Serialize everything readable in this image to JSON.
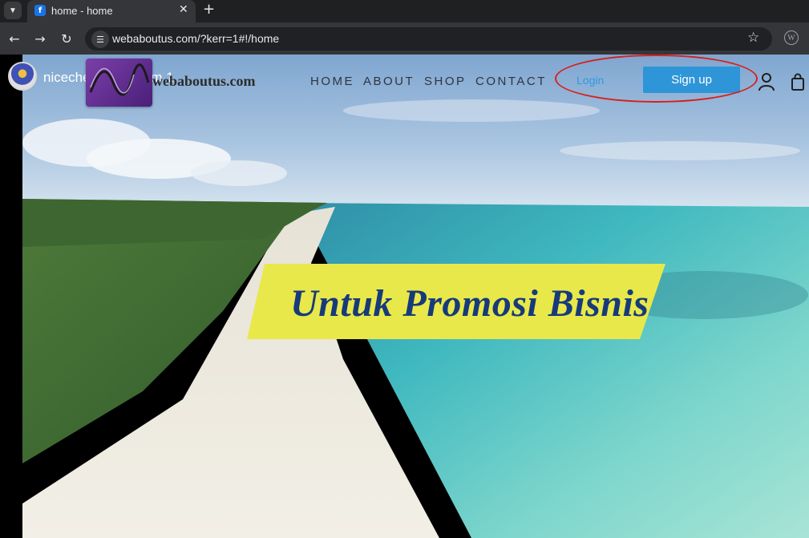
{
  "browser": {
    "tab_title": "home - home",
    "tab_favicon": "f",
    "url": "webaboutus.com/?kerr=1#!/home",
    "icons": [
      "tab-search-icon",
      "favicon-icon",
      "close-icon",
      "plus-icon",
      "back-arrow-icon",
      "forward-arrow-icon",
      "reload-icon",
      "site-info-icon",
      "star-icon",
      "wordpress-icon"
    ]
  },
  "site": {
    "name": "nicechea",
    "name_suffix": "om 1",
    "logo_text": "webaboutus.com",
    "nav": [
      "HOME",
      "ABOUT",
      "SHOP",
      "CONTACT"
    ],
    "login_label": "Login",
    "signup_label": "Sign up",
    "icons": [
      "user-icon",
      "shopping-bag-icon"
    ],
    "colors": {
      "signup_bg": "#2d95d8",
      "login_text": "#2d9be0",
      "annotation": "#d8201c"
    }
  },
  "hero": {
    "banner_text": "Untuk Promosi Bisnis",
    "colors": {
      "banner_bg": "#e8e84a",
      "banner_text": "#173a7a"
    }
  }
}
